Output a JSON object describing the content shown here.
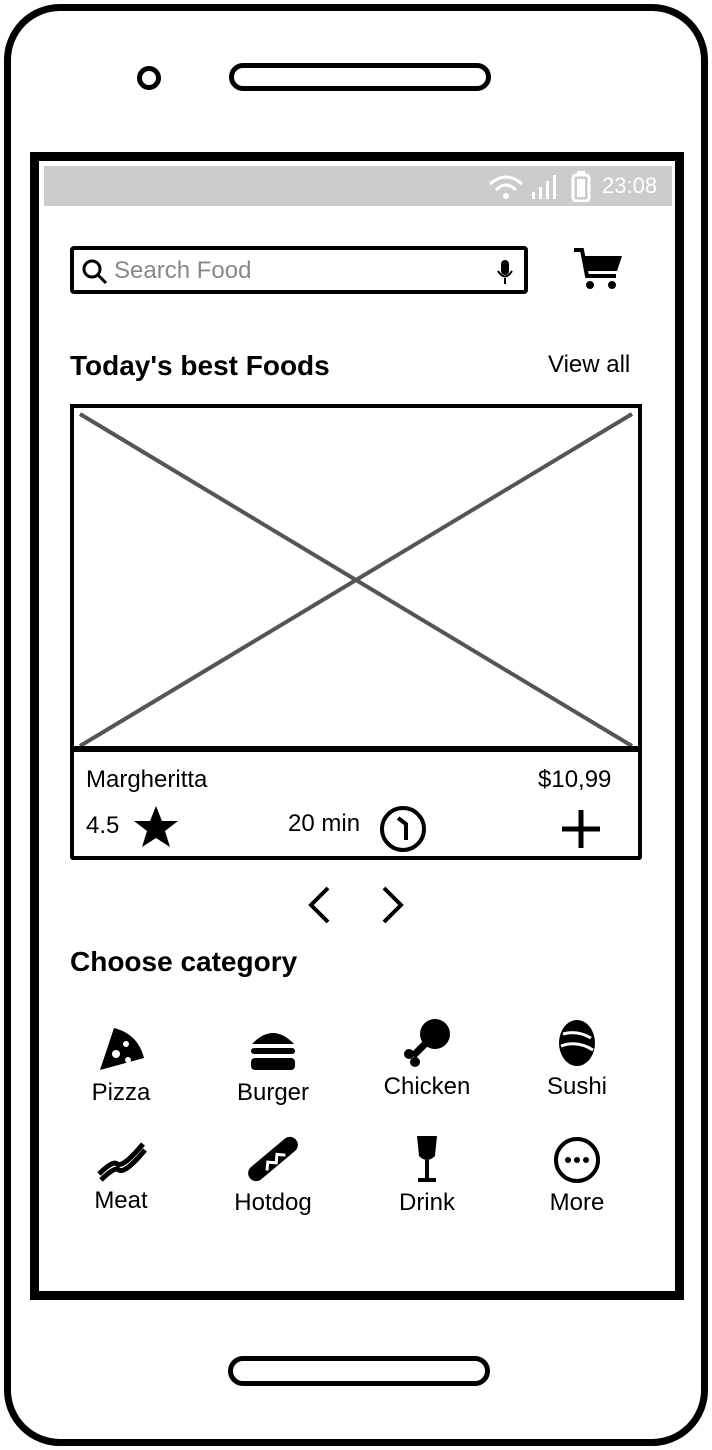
{
  "status_bar": {
    "time": "23:08"
  },
  "search": {
    "placeholder": "Search Food"
  },
  "section_best": {
    "title": "Today's best Foods",
    "view_all": "View all"
  },
  "food_card": {
    "name": "Margheritta",
    "price": "$10,99",
    "rating": "4.5",
    "time": "20 min"
  },
  "section_category": {
    "title": "Choose category"
  },
  "categories": [
    {
      "label": "Pizza",
      "icon": "pizza-icon"
    },
    {
      "label": "Burger",
      "icon": "burger-icon"
    },
    {
      "label": "Chicken",
      "icon": "chicken-icon"
    },
    {
      "label": "Sushi",
      "icon": "sushi-icon"
    },
    {
      "label": "Meat",
      "icon": "meat-icon"
    },
    {
      "label": "Hotdog",
      "icon": "hotdog-icon"
    },
    {
      "label": "Drink",
      "icon": "drink-icon"
    },
    {
      "label": "More",
      "icon": "more-icon"
    }
  ],
  "colors": {
    "status_bar": "#cccccc",
    "placeholder_text": "#888888",
    "image_cross": "#555555"
  }
}
